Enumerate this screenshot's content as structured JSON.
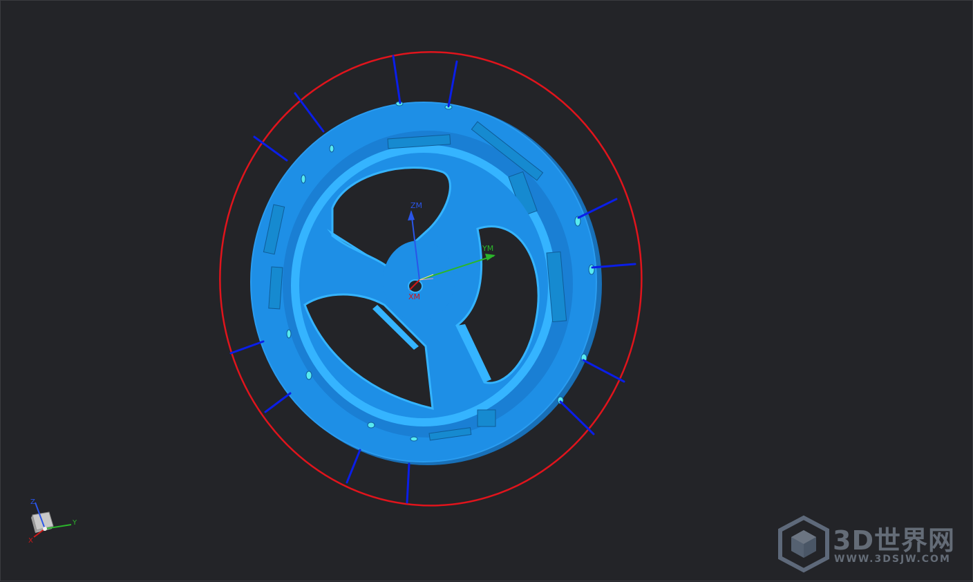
{
  "viewport": {
    "background": "#232428"
  },
  "model": {
    "part_color": "#1e8fe6",
    "part_light": "#35b4ff",
    "part_dark": "#1870b8",
    "bolt_circle_color": "#e0141c",
    "radial_line_color": "#0a1ee8",
    "hole_highlight_color": "#58eaf0"
  },
  "wcs": {
    "zm_label": "ZM",
    "ym_label": "YM",
    "xm_label": "XM",
    "zm_color": "#2a55e8",
    "ym_color": "#2bb52b",
    "xm_color": "#d01818"
  },
  "triad": {
    "z_label": "Z",
    "y_label": "Y",
    "x_label": "X",
    "cube_icon": "view-cube-icon"
  },
  "watermark": {
    "title": "3D世界网",
    "url": "WWW.3DSJW.COM",
    "logo_icon": "cube-logo-icon"
  }
}
